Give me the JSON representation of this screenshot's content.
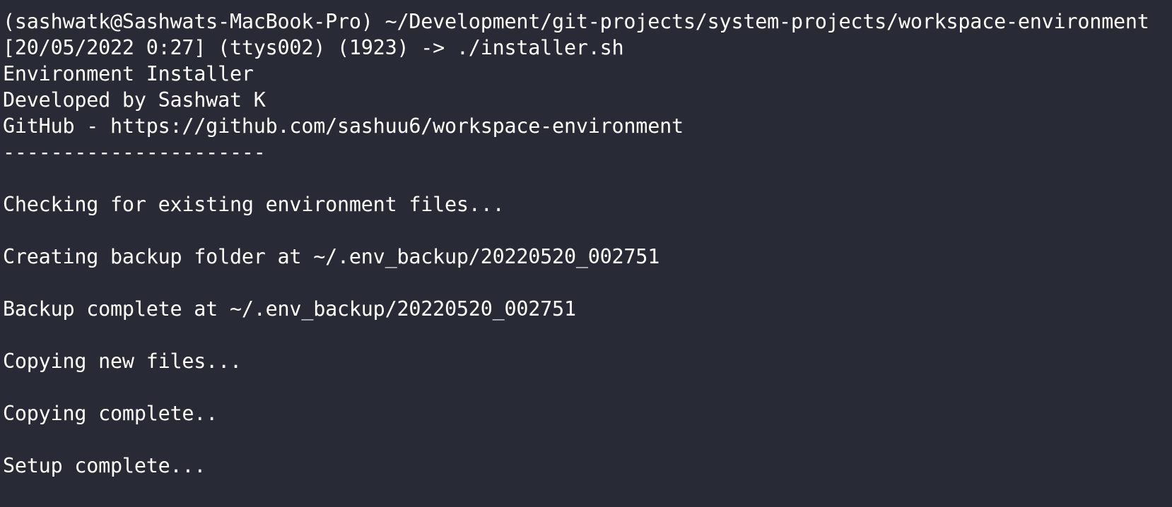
{
  "terminal": {
    "prompt_context": "(sashwatk@Sashwats-MacBook-Pro) ~/Development/git-projects/system-projects/workspace-environment",
    "prompt_command": "[20/05/2022 0:27] (ttys002) (1923) -> ./installer.sh",
    "output": {
      "header_title": "Environment Installer",
      "header_author": "Developed by Sashwat K",
      "header_repo": "GitHub - https://github.com/sashuu6/workspace-environment",
      "header_separator": "----------------------",
      "msg_checking": "Checking for existing environment files...",
      "msg_backup_create": "Creating backup folder at ~/.env_backup/20220520_002751",
      "msg_backup_done": "Backup complete at ~/.env_backup/20220520_002751",
      "msg_copying": "Copying new files...",
      "msg_copy_done": "Copying complete..",
      "msg_setup_done": "Setup complete..."
    }
  }
}
